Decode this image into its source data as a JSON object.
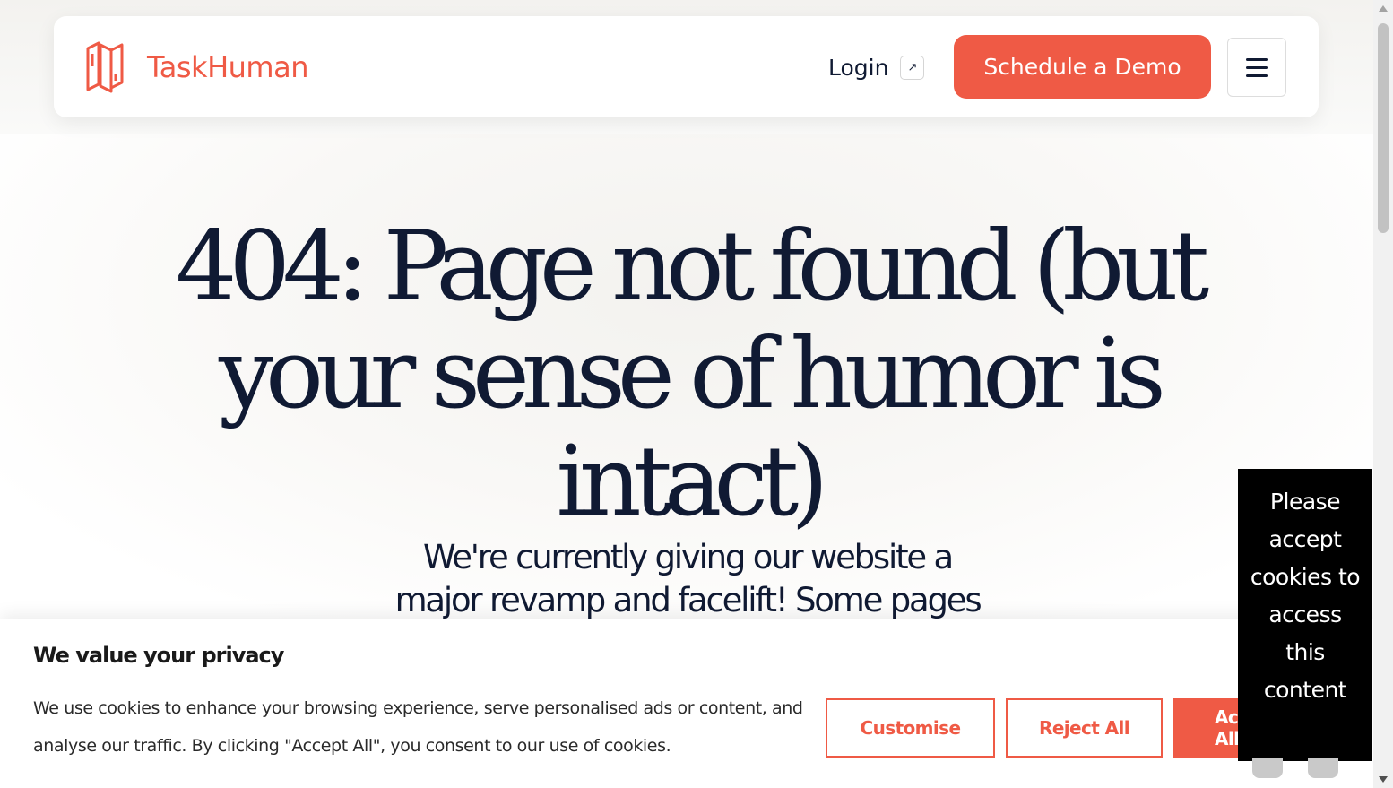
{
  "brand": {
    "name": "TaskHuman",
    "accent_color": "#ef5a45"
  },
  "nav": {
    "login_label": "Login",
    "login_icon": "arrow-up-right-icon",
    "demo_label": "Schedule a Demo",
    "menu_icon": "hamburger-menu-icon"
  },
  "main": {
    "headline": "404: Page not found (but your sense of humor is intact)",
    "subtext": "We're currently giving our website a major revamp and facelift! Some pages"
  },
  "cookie_banner": {
    "title": "We value your privacy",
    "text": "We use cookies to enhance your browsing experience, serve personalised ads or content, and analyse our traffic. By clicking \"Accept All\", you consent to our use of cookies.",
    "customise_label": "Customise",
    "reject_label": "Reject All",
    "accept_label": "Accept All"
  },
  "overlay": {
    "text": "Please accept cookies to access this content"
  },
  "colors": {
    "text_dark": "#101a33",
    "overlay_bg": "#000000"
  }
}
